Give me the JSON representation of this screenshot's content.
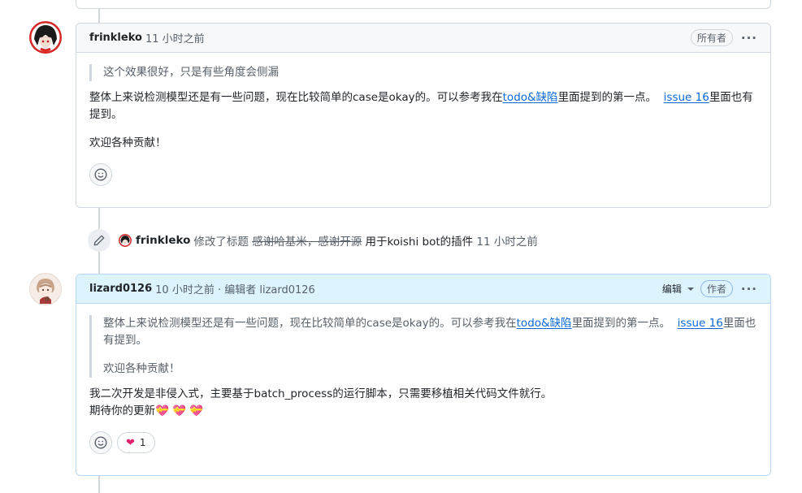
{
  "comment1": {
    "author": "frinkleko",
    "time": "11 小时之前",
    "badge": "所有者",
    "more": "···",
    "quote": "这个效果很好，只是有些角度会侧漏",
    "para1_before": "整体上来说检测模型还是有一些问题，现在比较简单的case是okay的。可以参考我在",
    "para1_link1": "todo&缺陷",
    "para1_middle": "里面提到的第一点。",
    "para1_link2": "issue 16",
    "para1_after": "里面也有提到。",
    "para2": "欢迎各种贡献！",
    "reaction_icon": "smiley-icon"
  },
  "event": {
    "icon": "pencil-icon",
    "author": "frinkleko",
    "action": "修改了标题",
    "old_title": "感谢哈基米，感谢开源",
    "new_title": "用于koishi bot的插件",
    "time": "11 小时之前"
  },
  "comment2": {
    "author": "lizard0126",
    "meta": "10 小时之前 · 编辑者 lizard0126",
    "edited_label": "编辑",
    "badge": "作者",
    "more": "···",
    "quote_before": "整体上来说检测模型还是有一些问题，现在比较简单的case是okay的。可以参考我在",
    "quote_link1": "todo&缺陷",
    "quote_middle": "里面提到的第一点。",
    "quote_link2": "issue 16",
    "quote_after": "里面也有提到。",
    "quote2": "欢迎各种贡献！",
    "line1": "我二次开发是非侵入式，主要基于batch_process的运行脚本，只需要移植相关代码文件就行。",
    "line2": "期待你的更新",
    "emojis": "💝 💝 💝",
    "heart": "❤",
    "heart_count": "1"
  },
  "colors": {
    "link": "#0969da",
    "blue_header": "#ddf4ff",
    "border": "#d0d7de"
  }
}
